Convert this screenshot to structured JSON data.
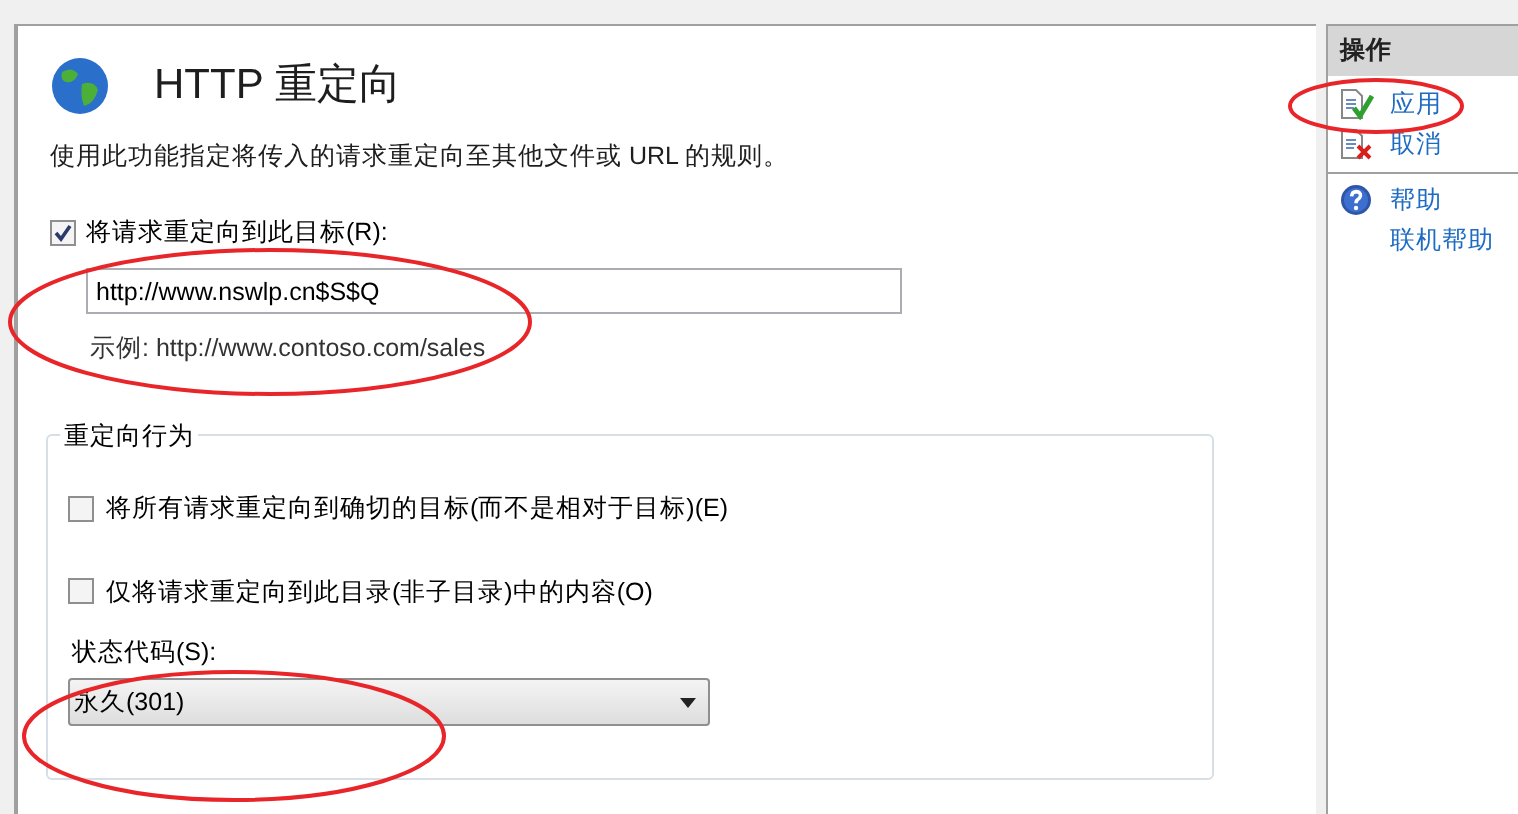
{
  "feature": {
    "title": "HTTP 重定向",
    "description": "使用此功能指定将传入的请求重定向至其他文件或 URL 的规则。"
  },
  "redirect_target": {
    "label": "将请求重定向到此目标(R):",
    "checked": true,
    "value": "http://www.nswlp.cn$S$Q",
    "example": "示例: http://www.contoso.com/sales"
  },
  "behavior": {
    "title": "重定向行为",
    "options": [
      {
        "label": "将所有请求重定向到确切的目标(而不是相对于目标)(E)",
        "checked": false
      },
      {
        "label": "仅将请求重定向到此目录(非子目录)中的内容(O)",
        "checked": false
      }
    ],
    "status_code": {
      "label": "状态代码(S):",
      "value": "永久(301)"
    }
  },
  "actions": {
    "title": "操作",
    "groups": [
      [
        {
          "label": "应用",
          "kind": "apply"
        },
        {
          "label": "取消",
          "kind": "cancel"
        }
      ],
      [
        {
          "label": "帮助",
          "kind": "help"
        },
        {
          "label": "联机帮助",
          "kind": "none"
        }
      ]
    ]
  }
}
